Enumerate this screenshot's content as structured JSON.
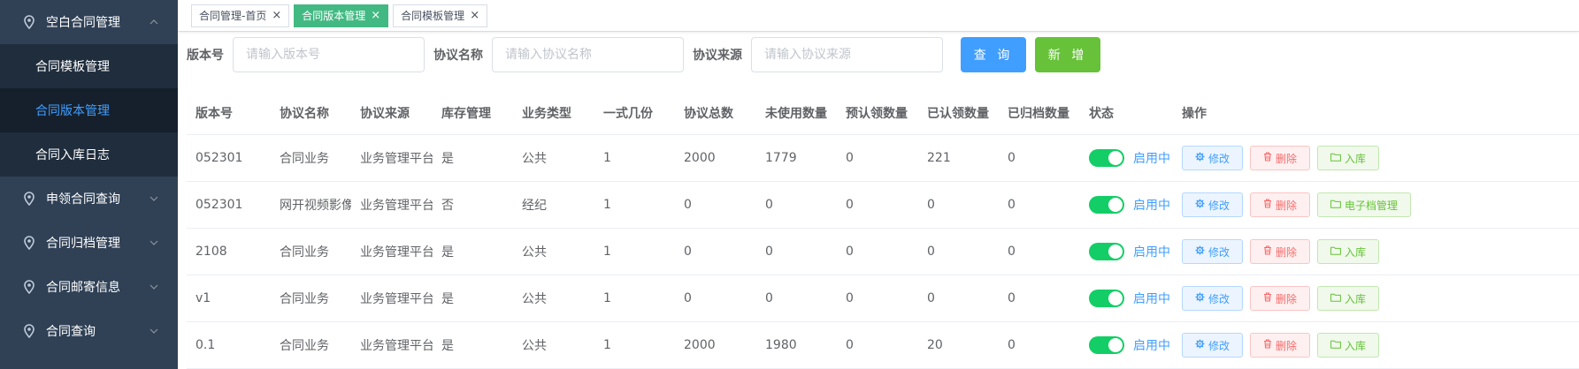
{
  "sidebar": {
    "groups": [
      {
        "label": "空白合同管理",
        "expanded": true,
        "items": [
          {
            "label": "合同模板管理",
            "active": false
          },
          {
            "label": "合同版本管理",
            "active": true
          },
          {
            "label": "合同入库日志",
            "active": false
          }
        ]
      },
      {
        "label": "申领合同查询"
      },
      {
        "label": "合同归档管理"
      },
      {
        "label": "合同邮寄信息"
      },
      {
        "label": "合同查询"
      }
    ]
  },
  "tabs": [
    {
      "label": "合同管理-首页",
      "active": false
    },
    {
      "label": "合同版本管理",
      "active": true
    },
    {
      "label": "合同模板管理",
      "active": false
    }
  ],
  "search": {
    "version_label": "版本号",
    "version_placeholder": "请输入版本号",
    "name_label": "协议名称",
    "name_placeholder": "请输入协议名称",
    "source_label": "协议来源",
    "source_placeholder": "请输入协议来源",
    "query_button": "查 询",
    "add_button": "新 增"
  },
  "table": {
    "columns": [
      "版本号",
      "协议名称",
      "协议来源",
      "库存管理",
      "业务类型",
      "一式几份",
      "协议总数",
      "未使用数量",
      "预认领数量",
      "已认领数量",
      "已归档数量",
      "状态",
      "操作"
    ],
    "status_text": "启用中",
    "edit_label": "修改",
    "delete_label": "删除",
    "rows": [
      {
        "version": "052301",
        "name": "合同业务",
        "source": "业务管理平台",
        "stock": "是",
        "type": "公共",
        "copies": "1",
        "total": "2000",
        "unused": "1779",
        "pre_claimed": "0",
        "claimed": "221",
        "archived": "0",
        "action3": "入库"
      },
      {
        "version": "052301",
        "name": "网开视频影像",
        "source": "业务管理平台",
        "stock": "否",
        "type": "经纪",
        "copies": "1",
        "total": "0",
        "unused": "0",
        "pre_claimed": "0",
        "claimed": "0",
        "archived": "0",
        "action3": "电子档管理"
      },
      {
        "version": "2108",
        "name": "合同业务",
        "source": "业务管理平台",
        "stock": "是",
        "type": "公共",
        "copies": "1",
        "total": "0",
        "unused": "0",
        "pre_claimed": "0",
        "claimed": "0",
        "archived": "0",
        "action3": "入库"
      },
      {
        "version": "v1",
        "name": "合同业务",
        "source": "业务管理平台",
        "stock": "是",
        "type": "公共",
        "copies": "1",
        "total": "0",
        "unused": "0",
        "pre_claimed": "0",
        "claimed": "0",
        "archived": "0",
        "action3": "入库"
      },
      {
        "version": "0.1",
        "name": "合同业务",
        "source": "业务管理平台",
        "stock": "是",
        "type": "公共",
        "copies": "1",
        "total": "2000",
        "unused": "1980",
        "pre_claimed": "0",
        "claimed": "20",
        "archived": "0",
        "action3": "入库"
      }
    ]
  },
  "colors": {
    "sidebar_bg": "#304156",
    "submenu_bg": "#1f2d3d",
    "active_tab": "#42b983",
    "primary": "#409eff",
    "success": "#67c23a",
    "switch_on": "#13ce66"
  }
}
